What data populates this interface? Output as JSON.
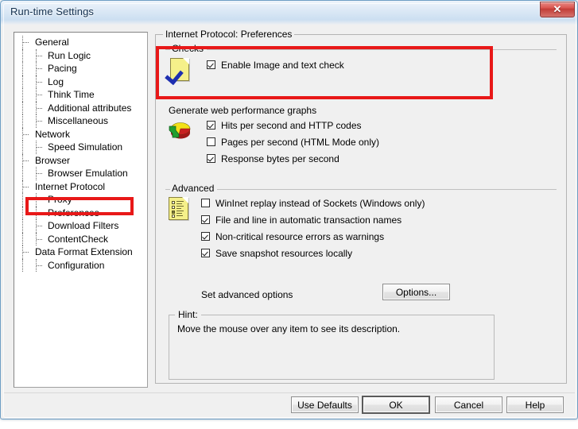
{
  "window": {
    "title": "Run-time Settings",
    "close_label": "✕",
    "close_icon": "close-icon"
  },
  "tree": {
    "items": [
      {
        "label": "General",
        "level": 1
      },
      {
        "label": "Run Logic",
        "level": 2
      },
      {
        "label": "Pacing",
        "level": 2
      },
      {
        "label": "Log",
        "level": 2
      },
      {
        "label": "Think Time",
        "level": 2
      },
      {
        "label": "Additional attributes",
        "level": 2
      },
      {
        "label": "Miscellaneous",
        "level": 2
      },
      {
        "label": "Network",
        "level": 1
      },
      {
        "label": "Speed Simulation",
        "level": 2
      },
      {
        "label": "Browser",
        "level": 1
      },
      {
        "label": "Browser Emulation",
        "level": 2
      },
      {
        "label": "Internet Protocol",
        "level": 1
      },
      {
        "label": "Proxy",
        "level": 2
      },
      {
        "label": "Preferences",
        "level": 2
      },
      {
        "label": "Download Filters",
        "level": 2
      },
      {
        "label": "ContentCheck",
        "level": 2
      },
      {
        "label": "Data Format Extension",
        "level": 1
      },
      {
        "label": "Configuration",
        "level": 2
      }
    ],
    "selected": "Preferences"
  },
  "content": {
    "group_title": "Internet Protocol: Preferences",
    "checks": {
      "title": "Checks",
      "icon": "yellow-page-check-icon",
      "options": [
        {
          "label": "Enable Image and text check",
          "checked": true
        }
      ]
    },
    "graphs": {
      "title": "Generate web performance graphs",
      "icon": "pie-chart-icon",
      "options": [
        {
          "label": "Hits per second and HTTP codes",
          "checked": true
        },
        {
          "label": "Pages per second (HTML Mode only)",
          "checked": false
        },
        {
          "label": "Response bytes per second",
          "checked": true
        }
      ]
    },
    "advanced": {
      "title": "Advanced",
      "icon": "yellow-form-list-icon",
      "options": [
        {
          "label": "WinInet replay instead of Sockets (Windows only)",
          "checked": false
        },
        {
          "label": "File and line in automatic transaction names",
          "checked": true
        },
        {
          "label": "Non-critical resource errors as warnings",
          "checked": true
        },
        {
          "label": "Save snapshot resources locally",
          "checked": true
        }
      ],
      "set_advanced_label": "Set advanced options",
      "options_button": "Options..."
    },
    "hint": {
      "title": "Hint:",
      "text": "Move the mouse over any item to see its description."
    }
  },
  "footer": {
    "buttons": [
      {
        "label": "Use Defaults",
        "default": false
      },
      {
        "label": "OK",
        "default": true
      },
      {
        "label": "Cancel",
        "default": false
      },
      {
        "label": "Help",
        "default": false
      }
    ]
  },
  "annotations": {
    "color": "#e81818",
    "boxes": [
      {
        "name": "checks-highlight"
      },
      {
        "name": "preferences-highlight"
      }
    ]
  }
}
